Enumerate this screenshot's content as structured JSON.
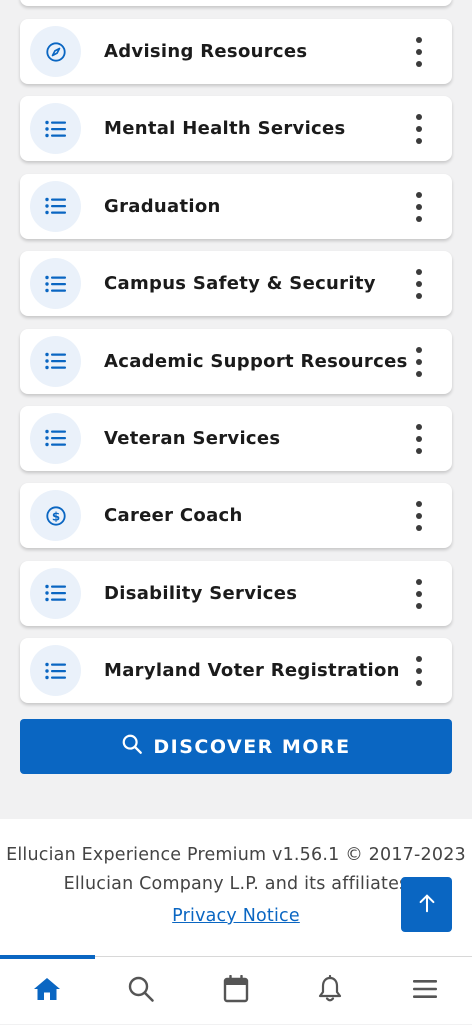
{
  "colors": {
    "accent": "#0a66c2",
    "icon_bg": "#eaf1fa",
    "text": "#1b1b1b",
    "footer_text": "#444444"
  },
  "list_items": [
    {
      "label": "Advising Resources",
      "icon": "compass-icon"
    },
    {
      "label": "Mental Health Services",
      "icon": "list-icon"
    },
    {
      "label": "Graduation",
      "icon": "list-icon"
    },
    {
      "label": "Campus Safety & Security",
      "icon": "list-icon"
    },
    {
      "label": "Academic Support Resources",
      "icon": "list-icon"
    },
    {
      "label": "Veteran Services",
      "icon": "list-icon"
    },
    {
      "label": "Career Coach",
      "icon": "dollar-icon"
    },
    {
      "label": "Disability Services",
      "icon": "list-icon"
    },
    {
      "label": "Maryland Voter Registration",
      "icon": "list-icon"
    }
  ],
  "discover": {
    "label": "DISCOVER MORE",
    "icon": "search-icon"
  },
  "footer": {
    "line1": "Ellucian Experience Premium v1.56.1 © 2017-2023",
    "line2": "Ellucian Company L.P. and its affiliates",
    "privacy": "Privacy Notice"
  },
  "back_to_top": {
    "icon": "arrow-up-icon"
  },
  "bottom_nav": [
    {
      "name": "home",
      "icon": "home-icon",
      "active": true
    },
    {
      "name": "search",
      "icon": "search-icon",
      "active": false
    },
    {
      "name": "calendar",
      "icon": "calendar-icon",
      "active": false
    },
    {
      "name": "notifications",
      "icon": "bell-icon",
      "active": false
    },
    {
      "name": "menu",
      "icon": "menu-icon",
      "active": false
    }
  ]
}
